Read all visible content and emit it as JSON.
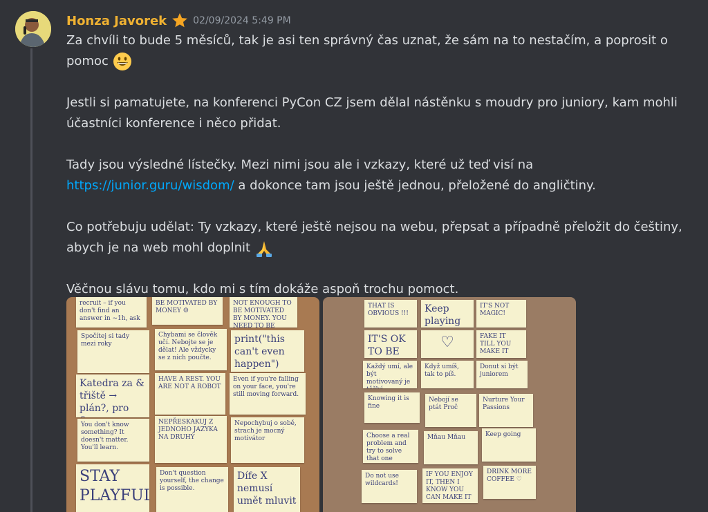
{
  "message": {
    "author": "Honza Javorek",
    "timestamp": "02/09/2024 5:49 PM",
    "paragraphs": {
      "p1": "Za chvíli to bude 5 měsíců, tak je asi ten správný čas uznat, že sám na to nestačím, a poprosit o pomoc",
      "p2": "Jestli si pamatujete, na konferenci PyCon CZ jsem dělal nástěnku s moudry pro juniory, kam mohli účastníci konference i něco přidat.",
      "p3_before": "Tady jsou výsledné lístečky. Mezi nimi jsou ale i vzkazy, které už teď visí na ",
      "p3_link": "https://junior.guru/wisdom/",
      "p3_after": " a dokonce tam jsou ještě jednou, přeložené do angličtiny.",
      "p4": "Co potřebuju udělat: Ty vzkazy, které ještě nejsou na webu, přepsat a případně přeložit do češtiny, abych je na web mohl doplnit",
      "p5": "Věčnou slávu tomu, kdo mi s tím dokáže aspoň trochu pomoct."
    },
    "emojis": [
      "grinning-face",
      "folded-hands"
    ]
  },
  "photos": {
    "left": {
      "notes": [
        "recruit – if you don't find an answer in ~1h, ask",
        "BE MOTIVATED BY MONEY ☺",
        "NOT ENOUGH TO BE MOTIVATED BY MONEY. YOU NEED TO BE PASSIONATE ABOUT TECH",
        "Spočítej si tady mezi roky",
        "Chybami se člověk učí. Nebojte se je dělat! Ale vždycky se z nich poučte.",
        "print(\"this can't even happen\")",
        "Katedra za & třiště → plán?, pro firmy",
        "HAVE A REST. YOU ARE NOT A ROBOT",
        "Even if you're falling on your face, you're still moving forward.",
        "You don't know something? It doesn't matter. You'll learn.",
        "NEPŘESKAKUJ Z JEDNOHO JAZYKA NA DRUHÝ",
        "Nepochybuj o sobě, strach je mocný motivátor",
        "STAY PLAYFUL",
        "Don't question yourself, the change is possible.",
        "Dífe X nemusí umět mluvit"
      ]
    },
    "right": {
      "notes": [
        "THAT IS OBVIOUS !!!",
        "Keep playing",
        "IT'S NOT MAGIC!",
        "IT'S OK TO BE MAD",
        "♡",
        "FAKE IT TILL YOU MAKE IT",
        "Každý umí, ale být motivovaný je těžké",
        "Když umíš, tak to píš.",
        "Donut si být juniorem",
        "Knowing it is fine",
        "Nebojí se ptát Proč",
        "Nurture Your Passions",
        "Choose a real problem and try to solve that one",
        "Mňau Mňau",
        "Keep going",
        "Do not use wildcards!",
        "IF YOU ENJOY IT, THEN I KNOW YOU CAN MAKE IT",
        "DRINK MORE COFFEE ♡"
      ]
    }
  }
}
